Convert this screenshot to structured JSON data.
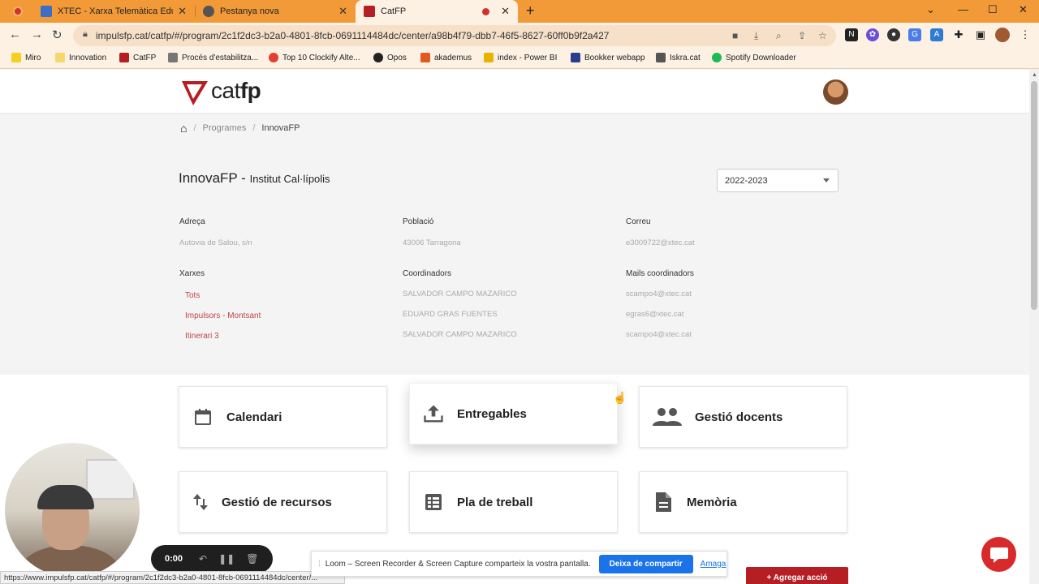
{
  "browser": {
    "tabs": [
      {
        "title": "XTEC - Xarxa Telemàtica Educatiu",
        "favicon_color": "#3b6fc4"
      },
      {
        "title": "Pestanya nova",
        "favicon_color": "#555555"
      },
      {
        "title": "CatFP",
        "favicon_color": "#b51e23"
      }
    ],
    "url": "impulsfp.cat/catfp/#/program/2c1f2dc3-b2a0-4801-8fcb-0691114484dc/center/a98b4f79-dbb7-46f5-8627-60ff0b9f2a427",
    "bookmarks": [
      {
        "label": "Miro",
        "color": "#f5d020"
      },
      {
        "label": "Innovation",
        "color": "#f5d76e"
      },
      {
        "label": "CatFP",
        "color": "#b51e23"
      },
      {
        "label": "Procés d'estabilitza...",
        "color": "#777777"
      },
      {
        "label": "Top 10 Clockify Alte...",
        "color": "#e2402c"
      },
      {
        "label": "Opos",
        "color": "#222222"
      },
      {
        "label": "akademus",
        "color": "#e05a1f"
      },
      {
        "label": "index - Power BI",
        "color": "#e8b400"
      },
      {
        "label": "Bookker webapp",
        "color": "#2b3d8f"
      },
      {
        "label": "Iskra.cat",
        "color": "#555555"
      },
      {
        "label": "Spotify Downloader",
        "color": "#1db954"
      }
    ],
    "status_url": "https://www.impulsfp.cat/catfp/#/program/2c1f2dc3-b2a0-4801-8fcb-0691114484dc/center/..."
  },
  "header": {
    "logo_light": "cat",
    "logo_bold": "fp",
    "brand_color": "#b51e23"
  },
  "breadcrumb": {
    "programes": "Programes",
    "current": "InnovaFP"
  },
  "center": {
    "program": "InnovaFP -",
    "institute": "Institut Cal·lípolis",
    "year": "2022-2023"
  },
  "info": {
    "adreca_label": "Adreça",
    "adreca": "Autovia de Salou, s/n",
    "poblacio_label": "Població",
    "poblacio": "43006 Tarragona",
    "correu_label": "Correu",
    "correu": "e3009722@xtec.cat",
    "xarxes_label": "Xarxes",
    "xarxes": [
      "Tots",
      "Impulsors - Montsant",
      "Itinerari 3"
    ],
    "coordinadors_label": "Coordinadors",
    "coordinadors": [
      "SALVADOR CAMPO MAZARICO",
      "EDUARD GRAS FUENTES",
      "SALVADOR CAMPO MAZARICO"
    ],
    "mails_label": "Mails coordinadors",
    "mails": [
      "scampo4@xtec.cat",
      "egras6@xtec.cat",
      "scampo4@xtec.cat"
    ]
  },
  "cards": [
    {
      "label": "Calendari",
      "icon": "calendar-icon"
    },
    {
      "label": "Entregables",
      "icon": "upload-icon"
    },
    {
      "label": "Gestió docents",
      "icon": "people-icon"
    },
    {
      "label": "Gestió de recursos",
      "icon": "swap-vertical-icon"
    },
    {
      "label": "Pla de treball",
      "icon": "list-alt-icon"
    },
    {
      "label": "Memòria",
      "icon": "document-icon"
    }
  ],
  "loom": {
    "time": "0:00",
    "share_message": "Loom – Screen Recorder & Screen Capture comparteix la vostra pantalla.",
    "stop_label": "Deixa de compartir",
    "hide_label": "Amaga"
  },
  "actions": {
    "add_label": "+ Agregar acció"
  }
}
